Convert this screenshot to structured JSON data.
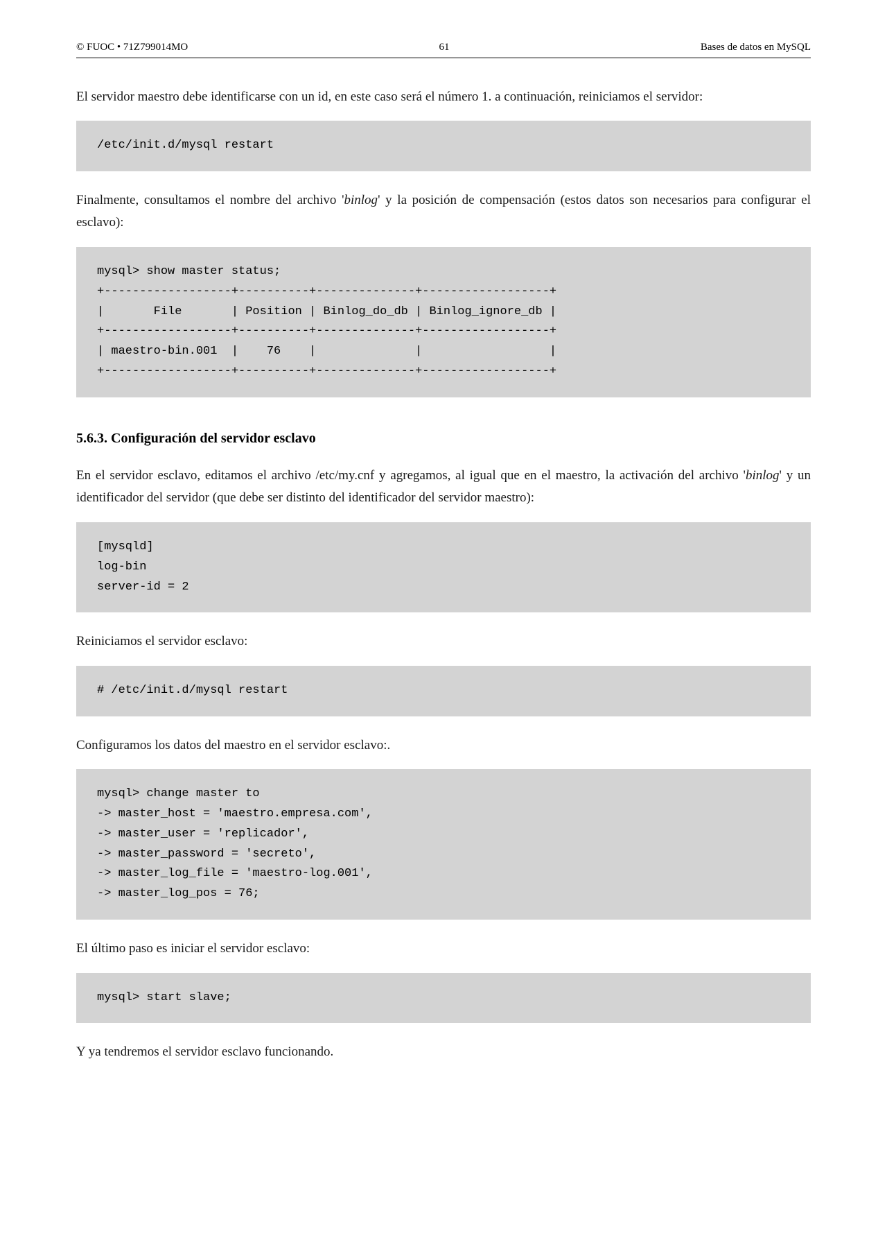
{
  "header": {
    "left": "© FUOC • 71Z799014MO",
    "center": "61",
    "right": "Bases de datos en MySQL"
  },
  "paragraphs": {
    "p1": "El servidor maestro debe identificarse con un id, en este caso será el número 1. a continuación, reiniciamos el servidor:",
    "p2a": "Finalmente, consultamos el nombre del archivo '",
    "p2b": "binlog",
    "p2c": "' y la posición de compensación (estos datos son necesarios para configurar el esclavo):",
    "p3a": "En el servidor esclavo, editamos el archivo /etc/my.cnf y agregamos, al igual que en el maestro, la activación del archivo '",
    "p3b": "binlog",
    "p3c": "' y un identificador del servidor (que debe ser distinto del identificador del servidor maestro):",
    "p4": "Reiniciamos el servidor esclavo:",
    "p5": "Configuramos los datos del maestro en el servidor esclavo:.",
    "p6": "El último paso es iniciar el servidor esclavo:",
    "p7": "Y ya tendremos el servidor esclavo funcionando."
  },
  "heading": "5.6.3.  Configuración del servidor esclavo",
  "code": {
    "c1": "/etc/init.d/mysql restart",
    "c2": "mysql> show master status;\n+------------------+----------+--------------+------------------+\n|       File       | Position | Binlog_do_db | Binlog_ignore_db |\n+------------------+----------+--------------+------------------+\n| maestro-bin.001  |    76    |              |                  |\n+------------------+----------+--------------+------------------+",
    "c3": "[mysqld]\nlog-bin\nserver-id = 2",
    "c4": "# /etc/init.d/mysql restart",
    "c5": "mysql> change master to\n-> master_host = 'maestro.empresa.com',\n-> master_user = 'replicador',\n-> master_password = 'secreto',\n-> master_log_file = 'maestro-log.001',\n-> master_log_pos = 76;",
    "c6": "mysql> start slave;"
  }
}
